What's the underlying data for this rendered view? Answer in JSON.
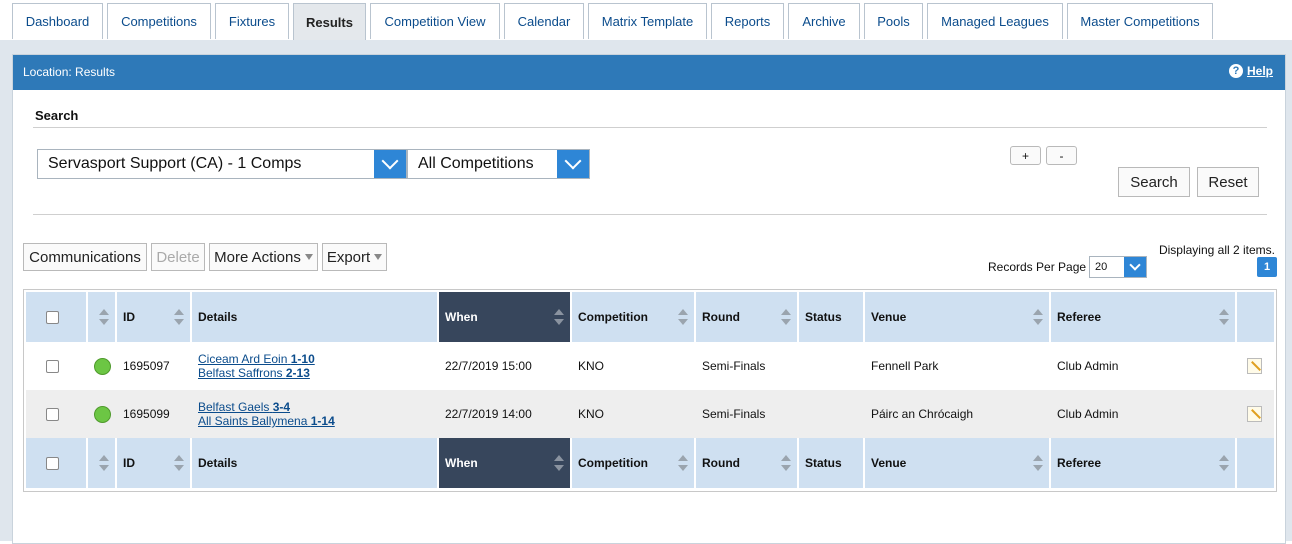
{
  "tabs": [
    {
      "label": "Dashboard",
      "active": false
    },
    {
      "label": "Competitions",
      "active": false
    },
    {
      "label": "Fixtures",
      "active": false
    },
    {
      "label": "Results",
      "active": true
    },
    {
      "label": "Competition View",
      "active": false
    },
    {
      "label": "Calendar",
      "active": false
    },
    {
      "label": "Matrix Template",
      "active": false
    },
    {
      "label": "Reports",
      "active": false
    },
    {
      "label": "Archive",
      "active": false
    },
    {
      "label": "Pools",
      "active": false
    },
    {
      "label": "Managed Leagues",
      "active": false
    },
    {
      "label": "Master Competitions",
      "active": false
    }
  ],
  "location": {
    "text": "Location: Results",
    "help_label": "Help",
    "help_icon": "?"
  },
  "search": {
    "title": "Search",
    "org_select": "Servasport Support (CA) - 1 Comps",
    "comp_select": "All Competitions",
    "plus_label": "+",
    "minus_label": "-",
    "search_button": "Search",
    "reset_button": "Reset"
  },
  "actions": {
    "communications": "Communications",
    "delete": "Delete",
    "more_actions": "More Actions",
    "export": "Export"
  },
  "paging": {
    "rpp_label": "Records Per Page",
    "rpp_value": "20",
    "displaying": "Displaying all 2 items.",
    "page": "1"
  },
  "table": {
    "headers": {
      "id": "ID",
      "details": "Details",
      "when": "When",
      "competition": "Competition",
      "round": "Round",
      "status": "Status",
      "venue": "Venue",
      "referee": "Referee"
    },
    "rows": [
      {
        "id": "1695097",
        "team1": "Ciceam Ard Eoin",
        "score1": "1-10",
        "team2": "Belfast Saffrons",
        "score2": "2-13",
        "when": "22/7/2019 15:00",
        "competition": "KNO",
        "round": "Semi-Finals",
        "status": "",
        "venue": "Fennell Park",
        "referee": "Club Admin"
      },
      {
        "id": "1695099",
        "team1": "Belfast Gaels",
        "score1": "3-4",
        "team2": "All Saints Ballymena",
        "score2": "1-14",
        "when": "22/7/2019 14:00",
        "competition": "KNO",
        "round": "Semi-Finals",
        "status": "",
        "venue": "Páirc an Chrócaigh",
        "referee": "Club Admin"
      }
    ]
  },
  "colors": {
    "accent": "#2e79b8",
    "when_header": "#37465c",
    "header_bg": "#cfe0f1",
    "status_dot": "#6cc644"
  }
}
